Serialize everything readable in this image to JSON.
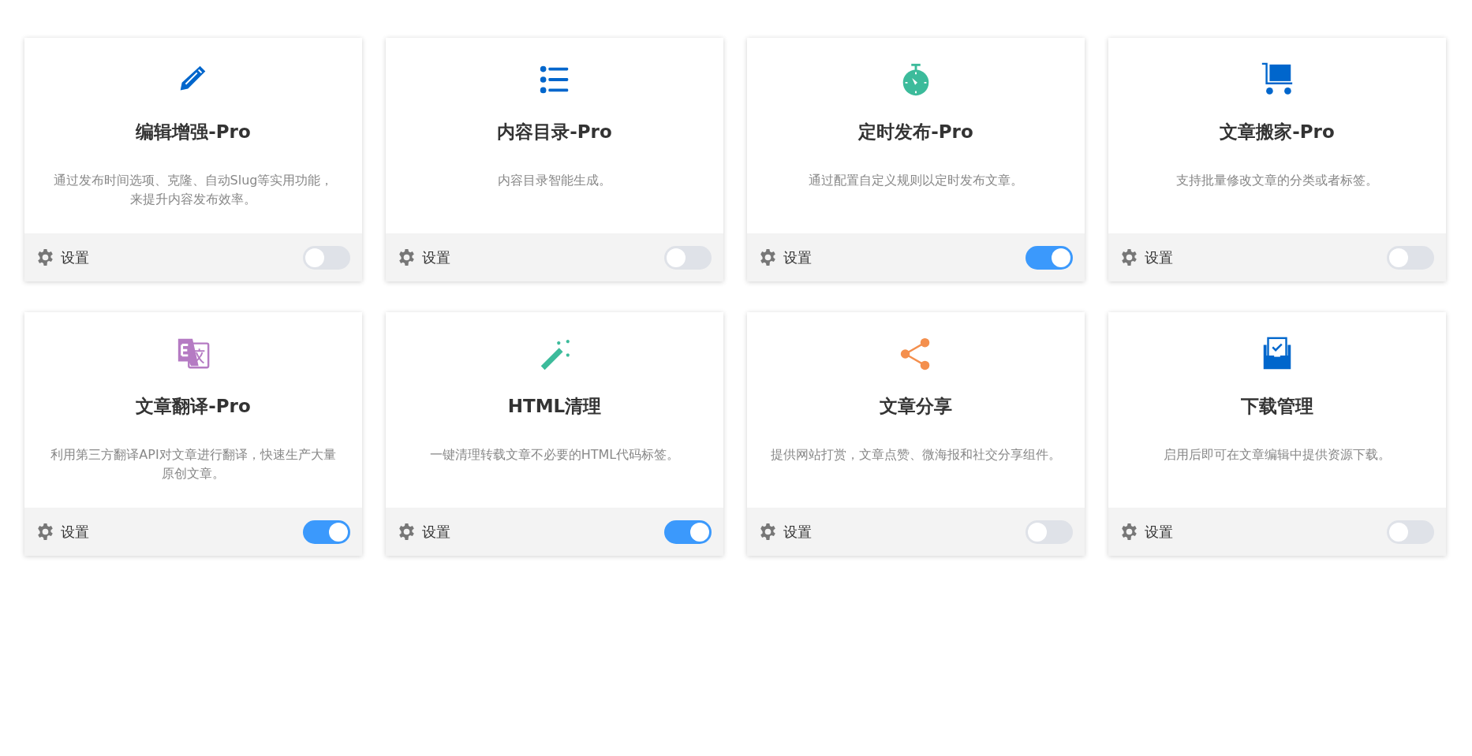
{
  "modules": [
    {
      "kind": "pencil",
      "title": "编辑增强-Pro",
      "description": "通过发布时间选项、克隆、自动Slug等实用功能，来提升内容发布效率。",
      "settings": "设置",
      "on": false
    },
    {
      "kind": "list",
      "title": "内容目录-Pro",
      "description": "内容目录智能生成。",
      "settings": "设置",
      "on": false
    },
    {
      "kind": "stopwatch",
      "title": "定时发布-Pro",
      "description": "通过配置自定义规则以定时发布文章。",
      "settings": "设置",
      "on": true
    },
    {
      "kind": "cart",
      "title": "文章搬家-Pro",
      "description": "支持批量修改文章的分类或者标签。",
      "settings": "设置",
      "on": false
    },
    {
      "kind": "translate",
      "title": "文章翻译-Pro",
      "description": "利用第三方翻译API对文章进行翻译，快速生产大量原创文章。",
      "settings": "设置",
      "on": true
    },
    {
      "kind": "wand",
      "title": "HTML清理",
      "description": "一键清理转载文章不必要的HTML代码标签。",
      "settings": "设置",
      "on": true
    },
    {
      "kind": "share",
      "title": "文章分享",
      "description": "提供网站打赏，文章点赞、微海报和社交分享组件。",
      "settings": "设置",
      "on": false
    },
    {
      "kind": "inbox",
      "title": "下载管理",
      "description": "启用后即可在文章编辑中提供资源下载。",
      "settings": "设置",
      "on": false
    }
  ]
}
